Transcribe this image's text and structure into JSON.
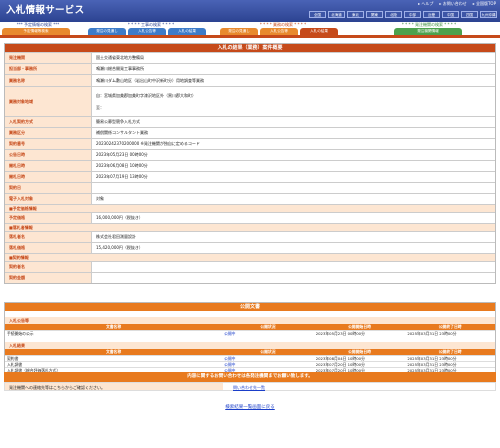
{
  "header": {
    "title": "入札情報サービス",
    "links": [
      "ヘルプ",
      "お問い合わせ",
      "全国版TOP"
    ],
    "regions": [
      "全国",
      "北海道",
      "東北",
      "関東",
      "北陸",
      "中部",
      "近畿",
      "中国",
      "四国",
      "九州沖縄"
    ]
  },
  "nav": {
    "groups": [
      {
        "title": "*** 予定情報の検索 ***",
        "tabs": [
          "予定情報等検索"
        ]
      },
      {
        "title": "* * * * 工事の検索 * * * *",
        "tabs": [
          "発注の見通し",
          "入札公告等",
          "入札の結果"
        ]
      },
      {
        "title": "* * * * 業務の検索 * * * *",
        "tabs": [
          "発注の見通し",
          "入札公告等",
          "入札の結果"
        ]
      },
      {
        "title": "* * * * 発注機関の検索 * * * *",
        "tabs": [
          "発注機関情報"
        ]
      }
    ]
  },
  "detail": {
    "title": "入札の結果（業務）案件概要",
    "rows": [
      {
        "label": "発注機関",
        "value": "国土交通省東北地方整備局"
      },
      {
        "label": "担当部・事務所",
        "value": "鳴瀬川総合開発工事事務所"
      },
      {
        "label": "業務名称",
        "value": "鳴瀬川ダム敷山地区（岩出山町中沢新町分）用地調査等業務"
      },
      {
        "label": "業務対象地域",
        "value": "自：宮城県加美郡加美町字漆沢地区外（黒川郡大和町）",
        "value2": "至："
      },
      {
        "label": "入札契約方式",
        "value": "簡易公募型競争入札方式"
      },
      {
        "label": "業務区分",
        "value": "補償関係コンサルタント業務"
      },
      {
        "label": "契約番号",
        "value": "20230242370200000    ※発注機関が独自に定めるコード"
      },
      {
        "label": "公告日時",
        "value": "2023年05月23日 00時00分"
      },
      {
        "label": "開札日時",
        "value": "2023年06月08日 10時00分"
      },
      {
        "label": "開札日時",
        "value": "2023年07月19日 13時00分"
      },
      {
        "label": "契約日",
        "value": ""
      },
      {
        "label": "電子入札対象",
        "value": "対象"
      }
    ],
    "section_budget": "■予定価格情報",
    "budget_rows": [
      {
        "label": "予定価格",
        "value": "16,000,000円（税抜き）"
      }
    ],
    "section_award": "■落札者情報",
    "award_rows": [
      {
        "label": "落札者名",
        "value": "株式会社君田測量設計"
      },
      {
        "label": "落札価格",
        "value": "15,420,000円（税抜き）"
      }
    ],
    "section_contract": "■契約情報",
    "contract_rows": [
      {
        "label": "契約者名",
        "value": ""
      },
      {
        "label": "契約金額",
        "value": ""
      }
    ]
  },
  "publications": {
    "title": "公開文書",
    "headers": [
      "文書名称",
      "公開状況",
      "公開開始日時",
      "公開終了日時"
    ],
    "group1": {
      "title": "入札公告等",
      "rows": [
        {
          "name": "手続開始の公示",
          "status": "公開中",
          "start": "2023年05月23日 00時00分",
          "end": "2025年03月31日 23時00分"
        }
      ]
    },
    "group2": {
      "title": "入札結果",
      "rows": [
        {
          "name": "契約書",
          "status": "公開中",
          "start": "2023年08月04日 10時00分",
          "end": "2025年03月31日 23時00分"
        },
        {
          "name": "入札調書",
          "status": "公開中",
          "start": "2023年07月20日 10時00分",
          "end": "2025年03月31日 23時00分"
        },
        {
          "name": "入札調書（総合評価落札方式）",
          "status": "公開中",
          "start": "2023年07月20日 10時00分",
          "end": "2025年03月31日 23時00分"
        }
      ]
    }
  },
  "inquiry": {
    "title": "内容に関するお問い合わせは各発注機関までお願い致します。",
    "label": "発注機関への連絡先等はこちらからご確認ください。",
    "link": "問い合わせ先一覧"
  },
  "footer": {
    "back_link": "検索結果一覧画面に戻る"
  },
  "colors": {
    "header_blue": "#2c4391",
    "accent_orange": "#c64a1a",
    "label_bg": "#fde6d2"
  }
}
